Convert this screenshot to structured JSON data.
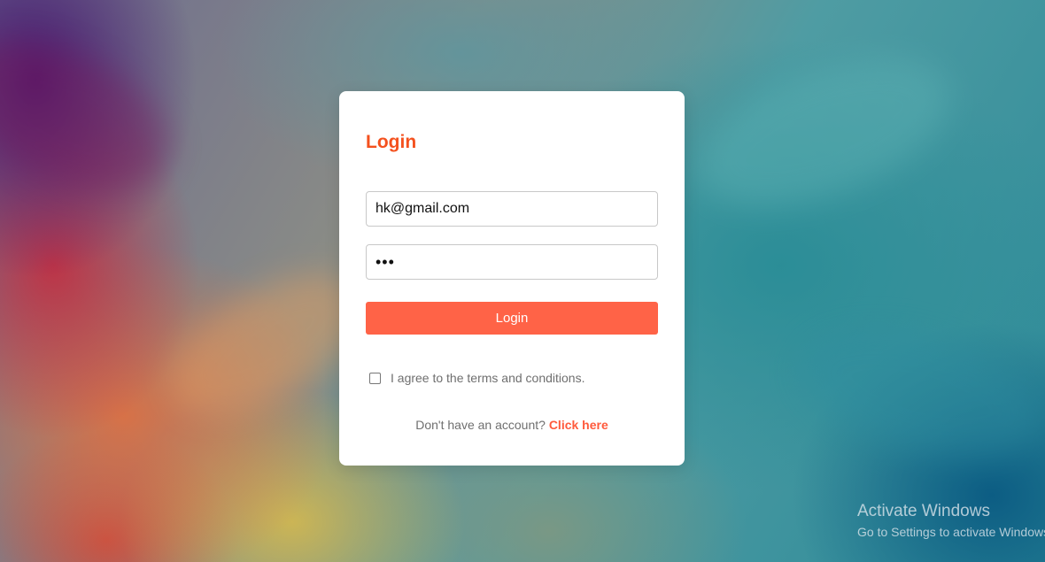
{
  "login": {
    "title": "Login",
    "email_value": "hk@gmail.com",
    "password_value": "•••",
    "button_label": "Login",
    "agree_text": "I agree to the terms and conditions.",
    "signup_prompt": "Don't have an account?",
    "signup_link": "Click here"
  },
  "colors": {
    "accent": "#f4511e",
    "button": "#ff6347",
    "link": "#ff5a3c"
  },
  "watermark": {
    "title": "Activate Windows",
    "subtitle": "Go to Settings to activate Windows."
  }
}
